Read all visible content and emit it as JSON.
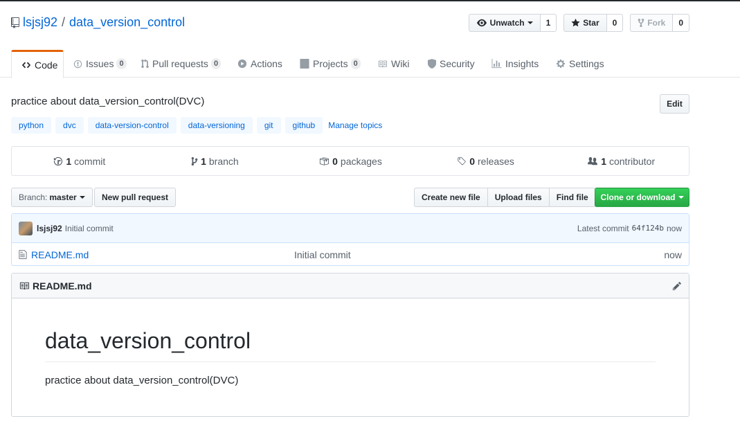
{
  "repo": {
    "owner": "lsjsj92",
    "separator": "/",
    "name": "data_version_control"
  },
  "social": {
    "watch_label": "Unwatch",
    "watch_count": "1",
    "star_label": "Star",
    "star_count": "0",
    "fork_label": "Fork",
    "fork_count": "0"
  },
  "tabs": [
    {
      "label": "Code"
    },
    {
      "label": "Issues",
      "count": "0"
    },
    {
      "label": "Pull requests",
      "count": "0"
    },
    {
      "label": "Actions"
    },
    {
      "label": "Projects",
      "count": "0"
    },
    {
      "label": "Wiki"
    },
    {
      "label": "Security"
    },
    {
      "label": "Insights"
    },
    {
      "label": "Settings"
    }
  ],
  "description": "practice about data_version_control(DVC)",
  "edit_label": "Edit",
  "topics": [
    "python",
    "dvc",
    "data-version-control",
    "data-versioning",
    "git",
    "github"
  ],
  "manage_topics": "Manage topics",
  "summary": {
    "commits_num": "1",
    "commits_label": "commit",
    "branches_num": "1",
    "branches_label": "branch",
    "packages_num": "0",
    "packages_label": "packages",
    "releases_num": "0",
    "releases_label": "releases",
    "contributors_num": "1",
    "contributors_label": "contributor"
  },
  "branch": {
    "label": "Branch:",
    "value": "master"
  },
  "new_pr_label": "New pull request",
  "file_actions": {
    "create": "Create new file",
    "upload": "Upload files",
    "find": "Find file"
  },
  "clone_label": "Clone or download",
  "commit_tease": {
    "author": "lsjsj92",
    "message": "Initial commit",
    "latest_label": "Latest commit",
    "sha": "64f124b",
    "age": "now"
  },
  "files": [
    {
      "name": "README.md",
      "message": "Initial commit",
      "age": "now"
    }
  ],
  "readme": {
    "header": "README.md",
    "title": "data_version_control",
    "body": "practice about data_version_control(DVC)"
  },
  "colors": {
    "link": "#0366d6",
    "tab_accent": "#e36209",
    "clone_green": "#28a745",
    "tease_bg": "#f1f8ff"
  },
  "icons": [
    "repo-icon",
    "eye-icon",
    "star-icon",
    "fork-icon",
    "code-icon",
    "issue-icon",
    "pull-request-icon",
    "play-icon",
    "project-icon",
    "book-icon",
    "shield-icon",
    "graph-icon",
    "gear-icon",
    "history-icon",
    "branch-icon",
    "package-icon",
    "tag-icon",
    "people-icon",
    "file-icon",
    "pencil-icon"
  ]
}
